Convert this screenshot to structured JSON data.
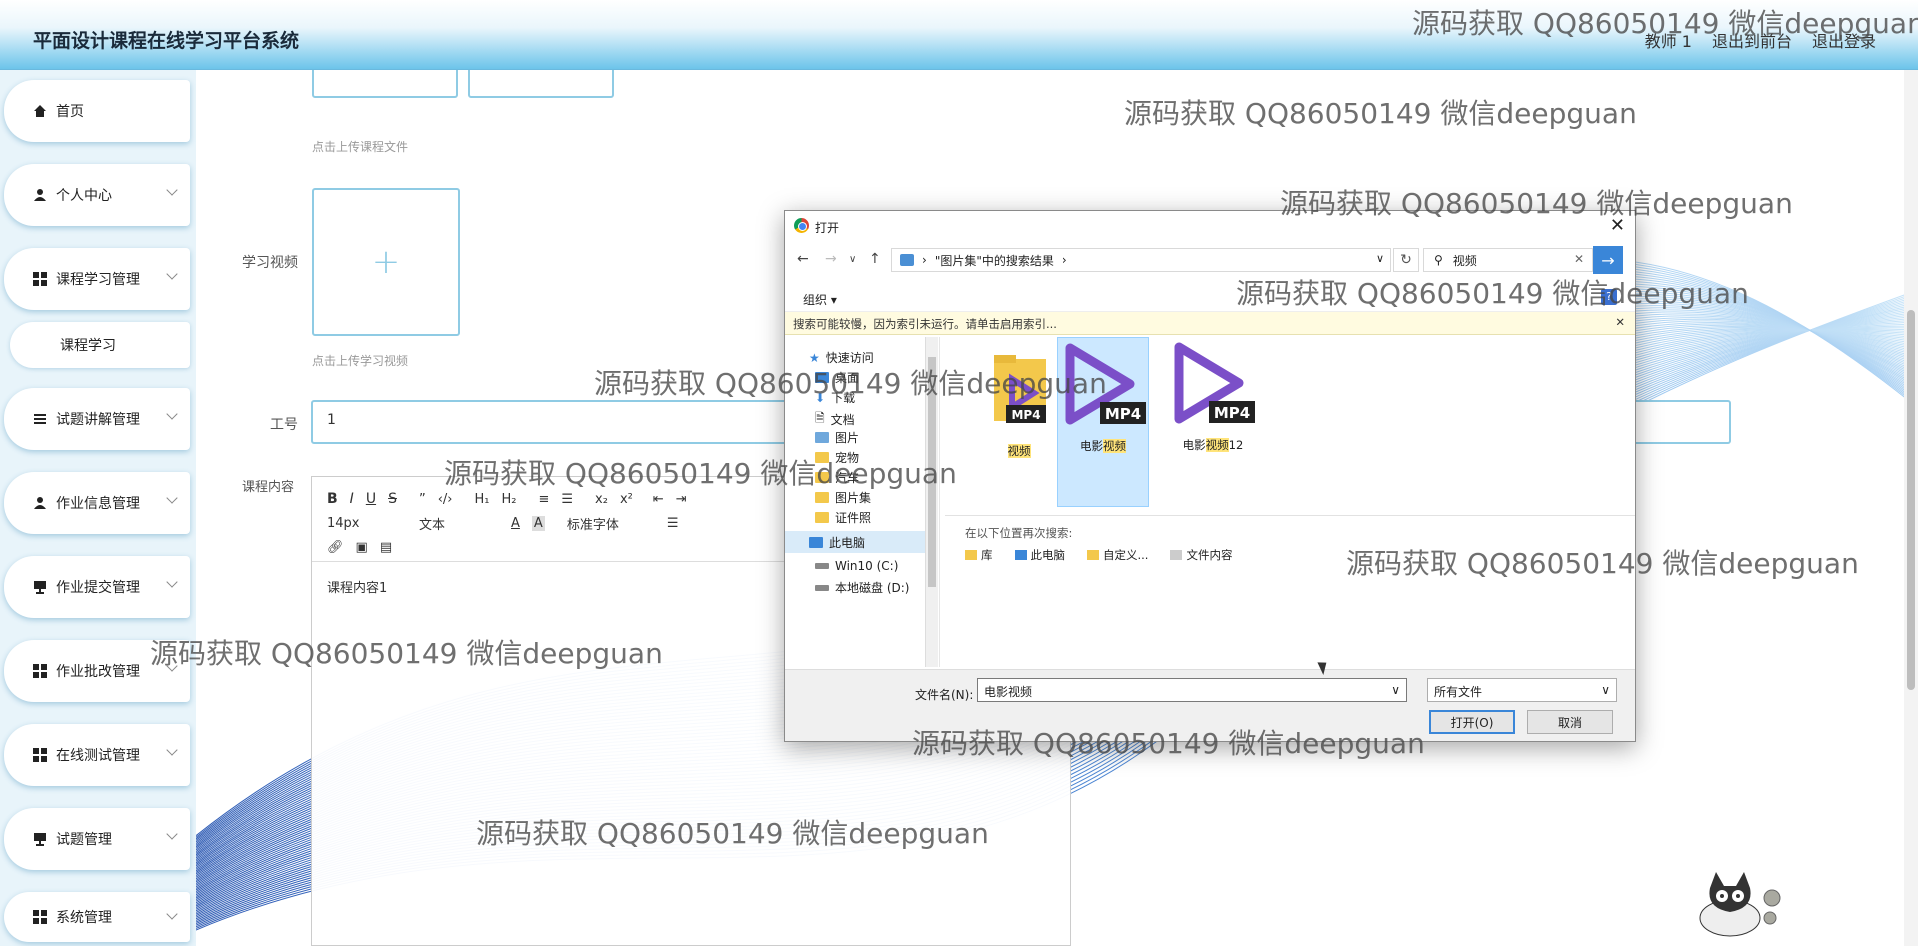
{
  "app": {
    "title": "平面设计课程在线学习平台系统"
  },
  "top_links": {
    "user": "教师 1",
    "front": "退出到前台",
    "logout": "退出登录"
  },
  "sidebar": {
    "items": [
      {
        "label": "首页",
        "icon": "home-icon"
      },
      {
        "label": "个人中心",
        "icon": "user-icon"
      },
      {
        "label": "课程学习管理",
        "icon": "grid-icon"
      },
      {
        "label": "课程学习",
        "icon": ""
      },
      {
        "label": "试题讲解管理",
        "icon": "list-icon"
      },
      {
        "label": "作业信息管理",
        "icon": "user-icon"
      },
      {
        "label": "作业提交管理",
        "icon": "monitor-icon"
      },
      {
        "label": "作业批改管理",
        "icon": "grid-icon"
      },
      {
        "label": "在线测试管理",
        "icon": "grid-icon"
      },
      {
        "label": "试题管理",
        "icon": "monitor-icon"
      },
      {
        "label": "系统管理",
        "icon": "grid-icon"
      }
    ]
  },
  "form": {
    "upload_file_hint": "点击上传课程文件",
    "video_label": "学习视频",
    "upload_video_hint": "点击上传学习视频",
    "worker_label": "工号",
    "worker_value": "1",
    "content_label": "课程内容",
    "editor": {
      "font_size": "14px",
      "format": "文本",
      "font_family": "标准字体",
      "content": "课程内容1"
    }
  },
  "dialog": {
    "title": "打开",
    "path": "\"图片集\"中的搜索结果",
    "search_value": "视频",
    "organize": "组织 ▾",
    "info_message": "搜索可能较慢，因为索引未运行。请单击启用索引...",
    "tree": [
      {
        "label": "快速访问",
        "icon": "star-icon"
      },
      {
        "label": "桌面",
        "icon": "desktop-icon"
      },
      {
        "label": "下载",
        "icon": "download-icon"
      },
      {
        "label": "文档",
        "icon": "document-icon"
      },
      {
        "label": "图片",
        "icon": "picture-icon"
      },
      {
        "label": "宠物",
        "icon": "folder-icon"
      },
      {
        "label": "汽车",
        "icon": "folder-icon"
      },
      {
        "label": "图片集",
        "icon": "folder-icon"
      },
      {
        "label": "证件照",
        "icon": "folder-icon"
      },
      {
        "label": "此电脑",
        "icon": "computer-icon"
      },
      {
        "label": "Win10 (C:)",
        "icon": "drive-icon"
      },
      {
        "label": "本地磁盘 (D:)",
        "icon": "drive-icon"
      }
    ],
    "files": [
      {
        "pre": "",
        "hl": "视频",
        "post": ""
      },
      {
        "pre": "电影",
        "hl": "视频",
        "post": ""
      },
      {
        "pre": "电影",
        "hl": "视频",
        "post": "12"
      }
    ],
    "mp4_badge": "MP4",
    "search_again": "在以下位置再次搜索:",
    "locations": [
      "库",
      "此电脑",
      "自定义...",
      "文件内容"
    ],
    "filename_label": "文件名(N):",
    "filename_value": "电影视频",
    "filetype": "所有文件",
    "open_button": "打开(O)",
    "cancel_button": "取消"
  },
  "watermark": "源码获取 QQ86050149 微信deepguan",
  "colors": {
    "accent": "#6cc4ea",
    "border": "#8fcbe4",
    "dialog_blue": "#3a86d8"
  }
}
